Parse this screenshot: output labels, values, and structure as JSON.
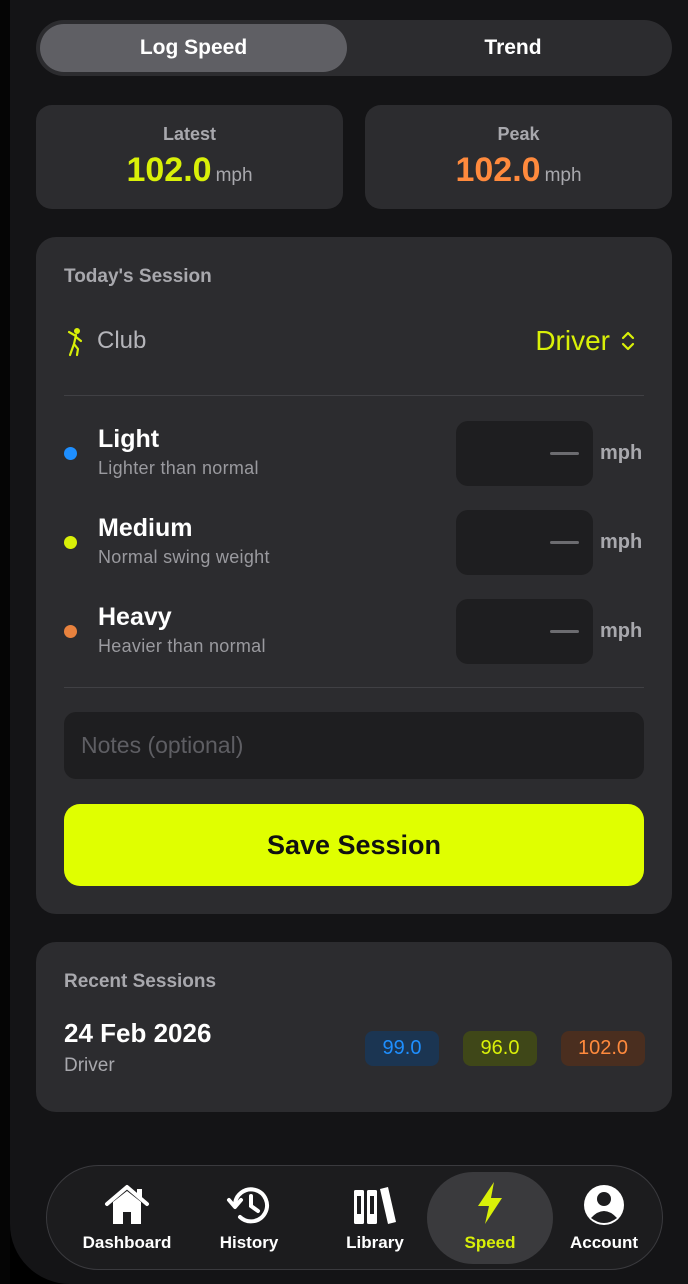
{
  "segmented": {
    "tabs": [
      "Log Speed",
      "Trend"
    ],
    "active": "Log Speed"
  },
  "stats": {
    "latest": {
      "label": "Latest",
      "value": "102.0",
      "unit": "mph",
      "color": "#d9f008"
    },
    "peak": {
      "label": "Peak",
      "value": "102.0",
      "unit": "mph",
      "color": "#ff8a3d"
    }
  },
  "session": {
    "title": "Today's Session",
    "club_label": "Club",
    "club_value": "Driver",
    "weights": [
      {
        "name": "Light",
        "desc": "Lighter than normal",
        "value": "—",
        "unit": "mph",
        "color": "#1e8fff"
      },
      {
        "name": "Medium",
        "desc": "Normal swing weight",
        "value": "—",
        "unit": "mph",
        "color": "#d9f008"
      },
      {
        "name": "Heavy",
        "desc": "Heavier than normal",
        "value": "—",
        "unit": "mph",
        "color": "#ff8a3d"
      }
    ],
    "notes_placeholder": "Notes (optional)",
    "save_label": "Save Session"
  },
  "recent": {
    "title": "Recent Sessions",
    "items": [
      {
        "date": "24 Feb 2026",
        "club": "Driver",
        "light": "99.0",
        "medium": "96.0",
        "heavy": "102.0"
      }
    ]
  },
  "tabbar": {
    "items": [
      {
        "label": "Dashboard",
        "icon": "house-icon"
      },
      {
        "label": "History",
        "icon": "clock-history-icon"
      },
      {
        "label": "Library",
        "icon": "books-icon"
      },
      {
        "label": "Speed",
        "icon": "bolt-icon"
      },
      {
        "label": "Account",
        "icon": "person-circle-icon"
      }
    ],
    "active": "Speed"
  },
  "colors": {
    "accent": "#e0ff00",
    "card": "#2c2c2f",
    "background": "#141416"
  }
}
